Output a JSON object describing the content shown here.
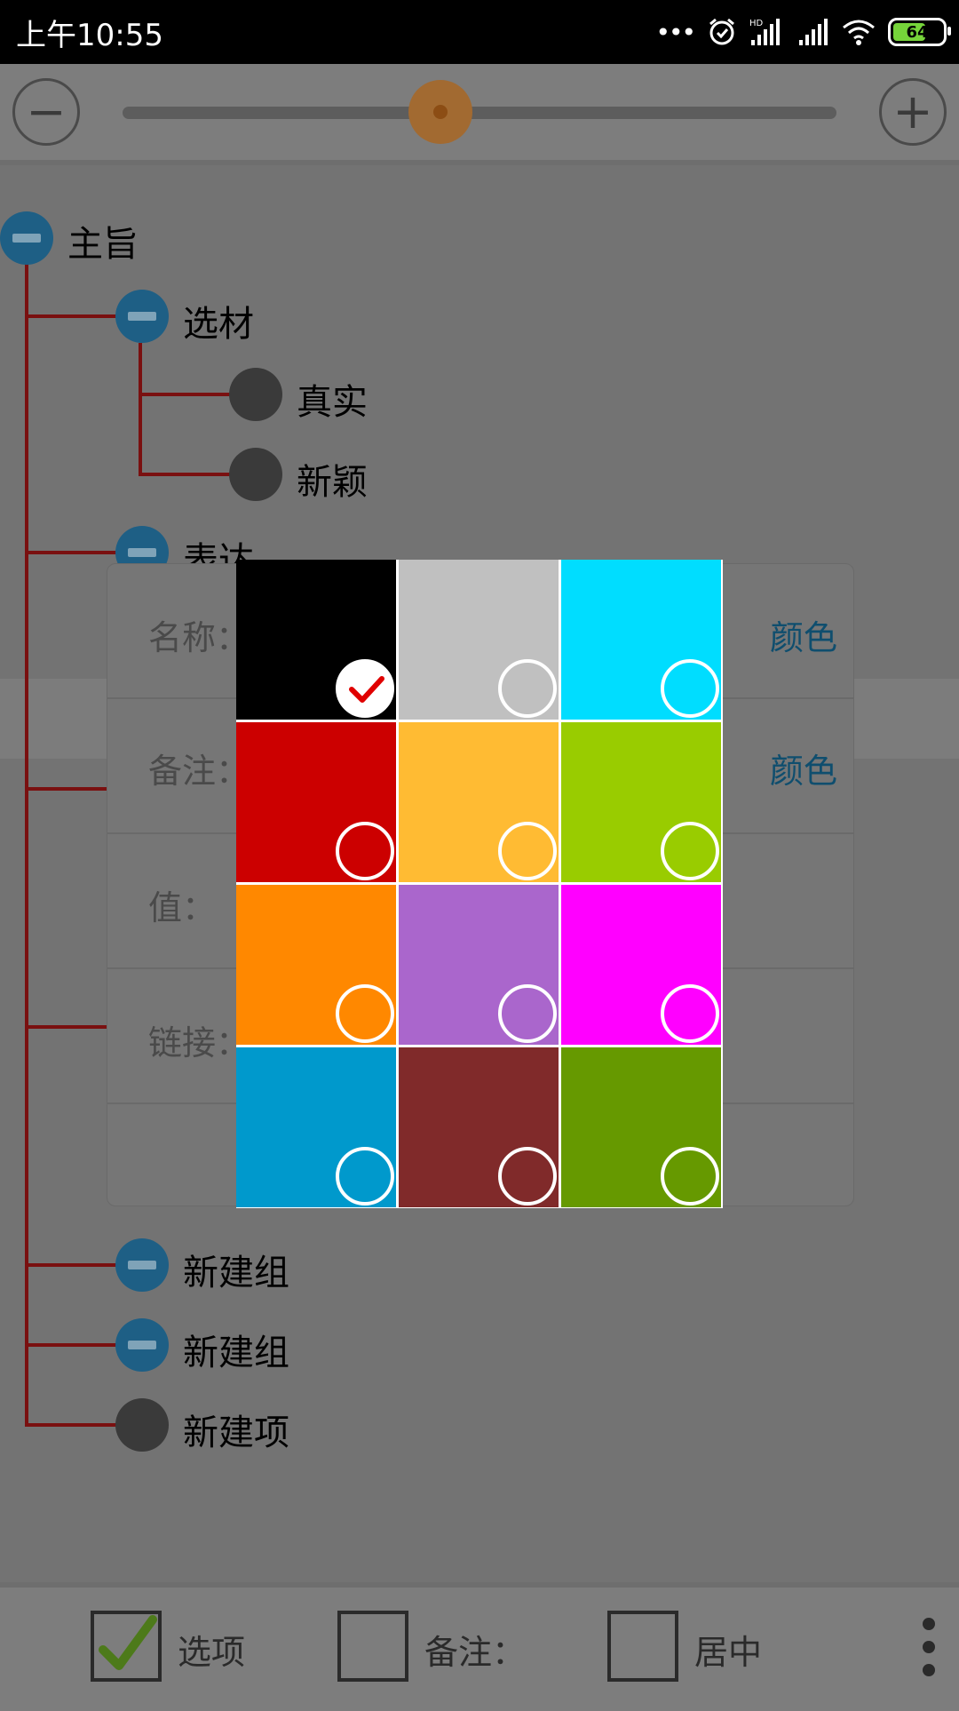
{
  "status_bar": {
    "time": "上午10:55",
    "battery": "64"
  },
  "toolbar": {
    "zoom_out_symbol": "−",
    "zoom_in_symbol": "+"
  },
  "tree": {
    "root": "主旨",
    "group1": "选材",
    "leaf1": "真实",
    "leaf2": "新颖",
    "group2": "表达",
    "group3": "新建组",
    "group4": "新建组",
    "leaf3": "新建项"
  },
  "dialog": {
    "name_label": "名称：",
    "name_color_link": "颜色",
    "note_label": "备注：",
    "note_color_link": "颜色",
    "value_label": "值：",
    "link_label": "链接："
  },
  "color_picker": {
    "colors": [
      "#000000",
      "#c0c0c0",
      "#00ddff",
      "#cc0000",
      "#ffbb33",
      "#99cc00",
      "#ff8800",
      "#aa66cc",
      "#ff00ff",
      "#0099cc",
      "#802a2a",
      "#669900"
    ],
    "selected_index": 0,
    "check_color": "#e00000"
  },
  "bottom_bar": {
    "options_label": "选项",
    "options_checked": true,
    "note_label": "备注：",
    "center_label": "居中"
  }
}
